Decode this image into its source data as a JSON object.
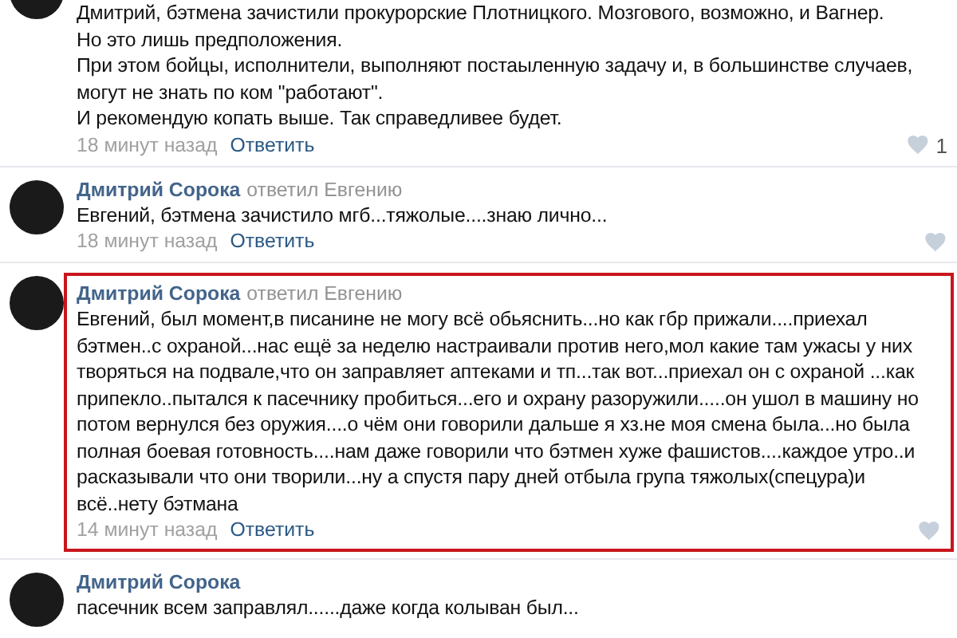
{
  "comments": [
    {
      "highlighted": false,
      "lines": [
        "Дмитрий, бэтмена зачистили прокурорские Плотницкого. Мозгового, возможно, и Вагнер.",
        "Но это лишь предположения.",
        "При этом бойцы, исполнители, выполняют постаыленную задачу и, в большинстве случаев, могут не знать по ком \"работают\".",
        "И рекомендую копать выше. Так справедливее будет."
      ],
      "time": "18 минут назад",
      "reply": "Ответить",
      "likes": "1"
    },
    {
      "author": "Дмитрий Сорока",
      "replied_to": "ответил Евгению",
      "highlighted": false,
      "lines": [
        "Евгений, бэтмена зачистило мгб...тяжолые....знаю лично..."
      ],
      "time": "18 минут назад",
      "reply": "Ответить"
    },
    {
      "author": "Дмитрий Сорока",
      "replied_to": "ответил Евгению",
      "highlighted": true,
      "lines": [
        "Евгений, был момент,в писанине не могу всё обьяснить...но как гбр прижали....приехал бэтмен..с охраной...нас ещё за неделю настраивали против него,мол какие там ужасы у них творяться на подвале,что он заправляет аптеками и тп...так вот...приехал он с охраной ...как припекло..пытался к пасечнику пробиться...его и охрану разоружили.....он ушол в машину но потом вернулся без оружия....о чём они говорили дальше я хз.не моя смена была...но была полная боевая готовность....нам даже говорили что бэтмен хуже фашистов....каждое утро..и расказывали что они творили...ну а спустя пару дней отбыла група тяжолых(спецура)и всё..нету бэтмана"
      ],
      "time": "14 минут назад",
      "reply": "Ответить"
    },
    {
      "author": "Дмитрий Сорока",
      "highlighted": false,
      "lines": [
        "пасечник всем заправлял......даже когда колыван был..."
      ]
    }
  ]
}
